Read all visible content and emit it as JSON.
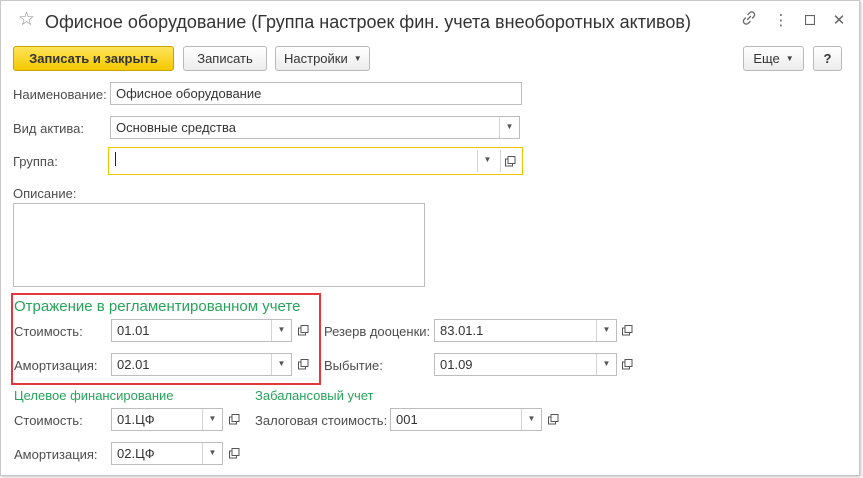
{
  "window": {
    "title": "Офисное оборудование (Группа настроек фин. учета внеоборотных активов)",
    "link_icon": "link-icon",
    "menu_icon": "more-vertical-icon",
    "minimize_icon": "minimize-icon",
    "close_icon": "close-icon"
  },
  "toolbar": {
    "save_close_label": "Записать и закрыть",
    "save_label": "Записать",
    "settings_label": "Настройки",
    "more_label": "Еще",
    "help_label": "?"
  },
  "form": {
    "name": {
      "label": "Наименование:",
      "value": "Офисное оборудование"
    },
    "asset_type": {
      "label": "Вид актива:",
      "value": "Основные средства"
    },
    "group": {
      "label": "Группа:",
      "value": ""
    },
    "description": {
      "label": "Описание:",
      "value": ""
    }
  },
  "regulated": {
    "title": "Отражение в регламентированном учете",
    "cost": {
      "label": "Стоимость:",
      "value": "01.01"
    },
    "amortization": {
      "label": "Амортизация:",
      "value": "02.01"
    },
    "revaluation_reserve": {
      "label": "Резерв дооценки:",
      "value": "83.01.1"
    },
    "disposal": {
      "label": "Выбытие:",
      "value": "01.09"
    }
  },
  "targeted": {
    "title": "Целевое финансирование",
    "cost": {
      "label": "Стоимость:",
      "value": "01.ЦФ"
    },
    "amortization": {
      "label": "Амортизация:",
      "value": "02.ЦФ"
    }
  },
  "offbalance": {
    "title": "Забалансовый учет",
    "collateral_cost": {
      "label": "Залоговая стоимость:",
      "value": "001"
    }
  },
  "colors": {
    "accent_yellow": "#f5c800",
    "section_green": "#28a35a",
    "highlight_red": "#e2393c"
  }
}
